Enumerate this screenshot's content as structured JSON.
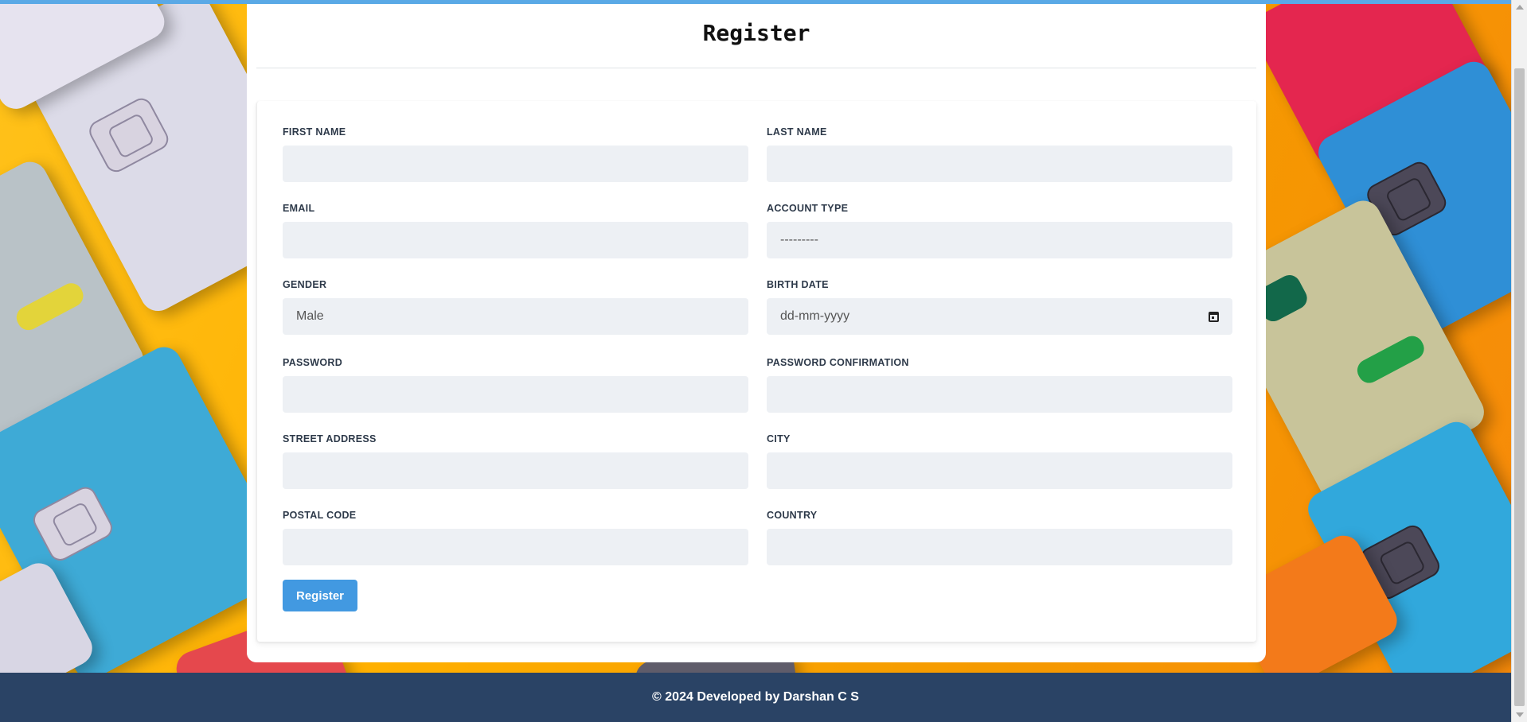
{
  "page": {
    "title": "Register"
  },
  "form": {
    "fields": [
      {
        "label": "FIRST NAME",
        "value": ""
      },
      {
        "label": "LAST NAME",
        "value": ""
      },
      {
        "label": "EMAIL",
        "value": ""
      },
      {
        "label": "ACCOUNT TYPE",
        "value": "---------"
      },
      {
        "label": "GENDER",
        "value": "Male"
      },
      {
        "label": "BIRTH DATE",
        "value": "dd-mm-yyyy"
      },
      {
        "label": "PASSWORD",
        "value": ""
      },
      {
        "label": "PASSWORD CONFIRMATION",
        "value": ""
      },
      {
        "label": "STREET ADDRESS",
        "value": ""
      },
      {
        "label": "CITY",
        "value": ""
      },
      {
        "label": "POSTAL CODE",
        "value": ""
      },
      {
        "label": "COUNTRY",
        "value": ""
      }
    ],
    "submit_label": "Register"
  },
  "footer": {
    "text": "© 2024 Developed by Darshan C S"
  },
  "colors": {
    "accent": "#4299e1",
    "footer_bg": "#2a4365",
    "input_bg": "#edf0f4"
  },
  "icons": {
    "birth_date": "calendar-icon"
  }
}
